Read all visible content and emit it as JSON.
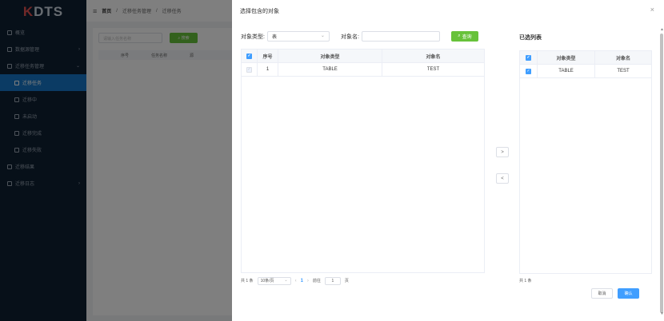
{
  "app": {
    "logo_prefix": "K",
    "logo_text": "DTS",
    "menu": [
      {
        "label": "概览",
        "icon": "grid-icon"
      },
      {
        "label": "数据源管理",
        "icon": "database-icon"
      },
      {
        "label": "迁移任务管理",
        "icon": "folder-icon"
      },
      {
        "label": "迁移任务",
        "icon": "list-icon"
      },
      {
        "label": "迁移中",
        "icon": "clock-icon"
      },
      {
        "label": "未启动",
        "icon": "circle-icon"
      },
      {
        "label": "迁移完成",
        "icon": "check-icon"
      },
      {
        "label": "迁移失败",
        "icon": "x-circle-icon"
      },
      {
        "label": "迁移结果",
        "icon": "file-icon"
      },
      {
        "label": "迁移日志",
        "icon": "log-icon"
      }
    ],
    "breadcrumb": [
      "首页",
      "迁移任务管理",
      "迁移任务"
    ],
    "bg_search_placeholder": "请输入任务名称",
    "bg_search_btn": "搜索",
    "bg_columns": [
      "序号",
      "任务名称",
      "源"
    ]
  },
  "drawer": {
    "title": "选择包含的对象",
    "close_glyph": "×",
    "filter": {
      "type_label": "对象类型:",
      "type_value": "表",
      "name_label": "对象名:",
      "name_value": "",
      "query_label": "查询"
    },
    "left_table": {
      "columns": [
        "序号",
        "对象类型",
        "对象名"
      ],
      "rows": [
        {
          "index": "1",
          "type": "TABLE",
          "name": "TEST",
          "checked": true,
          "disabled": true
        }
      ]
    },
    "pager": {
      "total": "共 1 条",
      "page_size": "10条/页",
      "current": "1",
      "goto_label": "前往",
      "goto_value": "1",
      "page_suffix": "页"
    },
    "transfer": {
      "to_right": ">",
      "to_left": "<"
    },
    "right": {
      "title": "已选列表",
      "columns": [
        "对象类型",
        "对象名"
      ],
      "rows": [
        {
          "type": "TABLE",
          "name": "TEST",
          "checked": true
        }
      ],
      "total": "共 1 条"
    },
    "actions": {
      "cancel": "取消",
      "confirm": "确认"
    }
  },
  "colors": {
    "primary": "#409eff",
    "success": "#67c23a",
    "sidebar": "#0f2033",
    "sidebar_active": "#1677c8"
  }
}
